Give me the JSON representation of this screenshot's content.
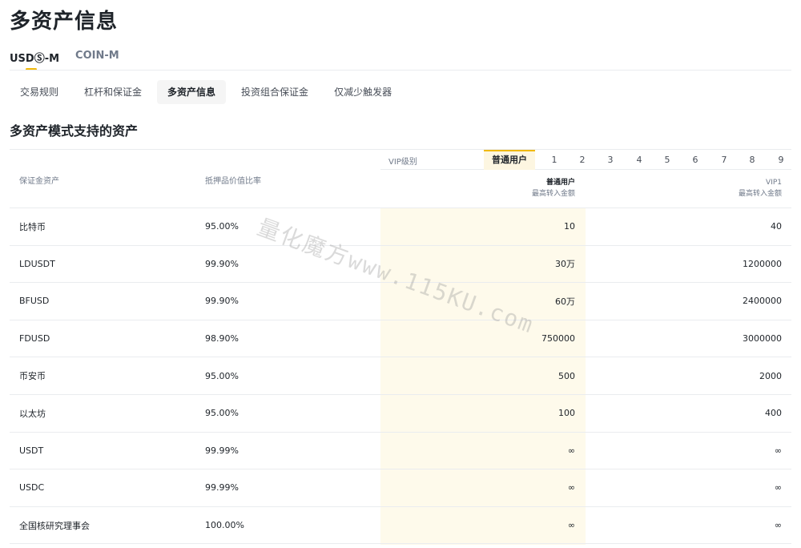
{
  "page": {
    "title": "多资产信息"
  },
  "top_tabs": [
    {
      "label": "USDⓈ-M",
      "active": true
    },
    {
      "label": "COIN-M",
      "active": false
    }
  ],
  "sub_tabs": [
    {
      "label": "交易规则",
      "active": false
    },
    {
      "label": "杠杆和保证金",
      "active": false
    },
    {
      "label": "多资产信息",
      "active": true
    },
    {
      "label": "投资组合保证金",
      "active": false
    },
    {
      "label": "仅减少触发器",
      "active": false
    }
  ],
  "section": {
    "title": "多资产模式支持的资产"
  },
  "table": {
    "headers": {
      "asset": "保证金资产",
      "ratio": "抵押品价值比率",
      "vip_label": "VIP级别",
      "col1_name": "普通用户",
      "col1_sub": "最高转入金额",
      "col2_name": "VIP1",
      "col2_sub": "最高转入金额"
    },
    "vip_levels": [
      "普通用户",
      "1",
      "2",
      "3",
      "4",
      "5",
      "6",
      "7",
      "8",
      "9"
    ],
    "rows": [
      {
        "asset": "比特币",
        "ratio": "95.00%",
        "v1": "10",
        "v2": "40"
      },
      {
        "asset": "LDUSDT",
        "ratio": "99.90%",
        "v1": "30万",
        "v2": "1200000"
      },
      {
        "asset": "BFUSD",
        "ratio": "99.90%",
        "v1": "60万",
        "v2": "2400000"
      },
      {
        "asset": "FDUSD",
        "ratio": "98.90%",
        "v1": "750000",
        "v2": "3000000"
      },
      {
        "asset": "币安币",
        "ratio": "95.00%",
        "v1": "500",
        "v2": "2000"
      },
      {
        "asset": "以太坊",
        "ratio": "95.00%",
        "v1": "100",
        "v2": "400"
      },
      {
        "asset": "USDT",
        "ratio": "99.99%",
        "v1": "∞",
        "v2": "∞"
      },
      {
        "asset": "USDC",
        "ratio": "99.99%",
        "v1": "∞",
        "v2": "∞"
      },
      {
        "asset": "全国核研究理事会",
        "ratio": "100.00%",
        "v1": "∞",
        "v2": "∞"
      }
    ]
  },
  "watermark": "量化魔方www.115KU.com",
  "colors": {
    "accent": "#f0b90b",
    "highlight": "#fefaeb",
    "text": "#1e2329",
    "muted": "#707a8a"
  }
}
